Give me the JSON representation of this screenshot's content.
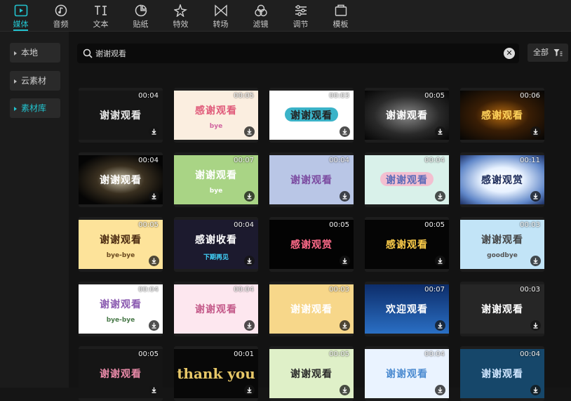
{
  "toolbar": {
    "tabs": [
      {
        "label": "媒体",
        "icon": "play-square-icon"
      },
      {
        "label": "音频",
        "icon": "music-note-icon"
      },
      {
        "label": "文本",
        "icon": "text-icon"
      },
      {
        "label": "贴纸",
        "icon": "sticker-icon"
      },
      {
        "label": "特效",
        "icon": "sparkle-icon"
      },
      {
        "label": "转场",
        "icon": "transition-icon"
      },
      {
        "label": "滤镜",
        "icon": "filter-circles-icon"
      },
      {
        "label": "调节",
        "icon": "sliders-icon"
      },
      {
        "label": "模板",
        "icon": "template-icon"
      }
    ],
    "active_index": 0,
    "accent_color": "#22c4cf"
  },
  "sidebar": {
    "items": [
      {
        "label": "本地"
      },
      {
        "label": "云素材"
      },
      {
        "label": "素材库"
      }
    ],
    "active_index": 2
  },
  "search": {
    "value": "谢谢观看",
    "clear_label": "✕"
  },
  "filter": {
    "label": "全部",
    "icon": "funnel-icon"
  },
  "assets": [
    {
      "duration": "00:04",
      "caption": "谢谢观看"
    },
    {
      "duration": "00:05",
      "caption": "感谢观看",
      "sub": "bye"
    },
    {
      "duration": "00:03",
      "caption": "谢谢观看"
    },
    {
      "duration": "00:05",
      "caption": "谢谢观看"
    },
    {
      "duration": "00:06",
      "caption": "感谢观看"
    },
    {
      "duration": "00:04",
      "caption": "谢谢观看"
    },
    {
      "duration": "00:07",
      "caption": "谢谢观看",
      "sub": "bye"
    },
    {
      "duration": "00:04",
      "caption": "谢谢观看"
    },
    {
      "duration": "00:04",
      "caption": "谢谢观看"
    },
    {
      "duration": "00:11",
      "caption": "感谢观赏"
    },
    {
      "duration": "00:05",
      "caption": "谢谢观看",
      "sub": "bye-bye"
    },
    {
      "duration": "00:04",
      "caption": "感谢收看",
      "sub": "下期再见"
    },
    {
      "duration": "00:05",
      "caption": "感谢观赏"
    },
    {
      "duration": "00:05",
      "caption": "感谢观看"
    },
    {
      "duration": "00:03",
      "caption": "谢谢观看",
      "sub": "goodbye"
    },
    {
      "duration": "00:04",
      "caption": "谢谢观看",
      "sub": "bye-bye"
    },
    {
      "duration": "00:04",
      "caption": "谢谢观看"
    },
    {
      "duration": "00:03",
      "caption": "谢谢观看"
    },
    {
      "duration": "00:07",
      "caption": "欢迎观看"
    },
    {
      "duration": "00:03",
      "caption": "谢谢观看"
    },
    {
      "duration": "00:05",
      "caption": "谢谢观看"
    },
    {
      "duration": "00:01",
      "caption": "thank you"
    },
    {
      "duration": "00:05",
      "caption": "谢谢观看"
    },
    {
      "duration": "00:04",
      "caption": "谢谢观看"
    },
    {
      "duration": "00:04",
      "caption": "谢谢观看"
    }
  ]
}
